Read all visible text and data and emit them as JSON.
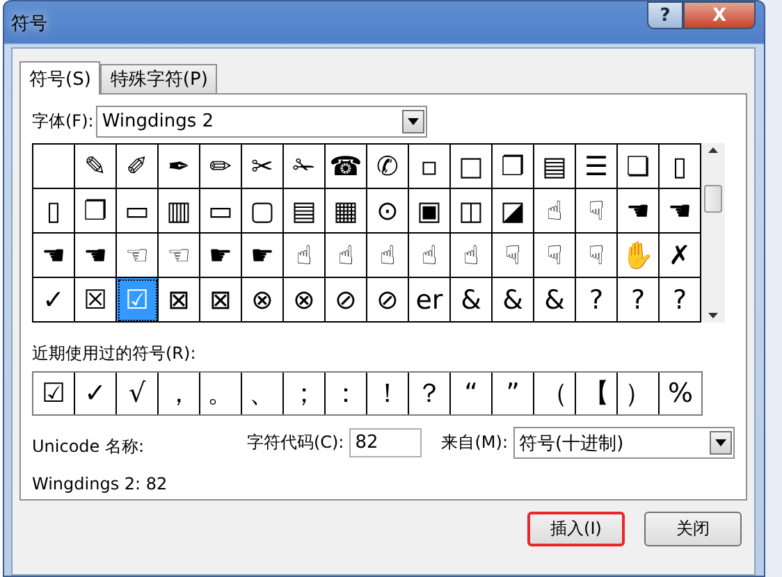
{
  "window": {
    "title": "符号",
    "help_button": "?",
    "close_button": "X"
  },
  "tabs": [
    {
      "label": "符号(S)",
      "selected": true
    },
    {
      "label": "特殊字符(P)",
      "selected": false
    }
  ],
  "font": {
    "label": "字体(F):",
    "value": "Wingdings 2"
  },
  "symbols": [
    {
      "selected": false
    },
    {
      "glyph": "✎",
      "selected": false
    },
    {
      "glyph": "✐",
      "selected": false
    },
    {
      "glyph": "✒",
      "selected": false
    },
    {
      "glyph": "✏",
      "selected": false
    },
    {
      "glyph": "✂",
      "selected": false
    },
    {
      "glyph": "✁",
      "selected": false
    },
    {
      "glyph": "☎",
      "selected": false
    },
    {
      "glyph": "✆",
      "selected": false
    },
    {
      "glyph": "▫",
      "selected": false
    },
    {
      "glyph": "□",
      "selected": false
    },
    {
      "glyph": "❐",
      "selected": false
    },
    {
      "glyph": "▤",
      "selected": false
    },
    {
      "glyph": "☰",
      "selected": false
    },
    {
      "glyph": "❏",
      "selected": false
    },
    {
      "glyph": "▯",
      "selected": false
    },
    {
      "glyph": "▯",
      "selected": false
    },
    {
      "glyph": "❐",
      "selected": false
    },
    {
      "glyph": "▭",
      "selected": false
    },
    {
      "glyph": "▥",
      "selected": false
    },
    {
      "glyph": "▭",
      "selected": false
    },
    {
      "glyph": "▢",
      "selected": false
    },
    {
      "glyph": "▤",
      "selected": false
    },
    {
      "glyph": "▦",
      "selected": false
    },
    {
      "glyph": "⊙",
      "selected": false
    },
    {
      "glyph": "▣",
      "selected": false
    },
    {
      "glyph": "◫",
      "selected": false
    },
    {
      "glyph": "◪",
      "selected": false
    },
    {
      "glyph": "☝",
      "selected": false
    },
    {
      "glyph": "☟",
      "selected": false
    },
    {
      "glyph": "☚",
      "selected": false
    },
    {
      "glyph": "☚",
      "selected": false
    },
    {
      "glyph": "☚",
      "selected": false
    },
    {
      "glyph": "☚",
      "selected": false
    },
    {
      "glyph": "☜",
      "selected": false
    },
    {
      "glyph": "☜",
      "selected": false
    },
    {
      "glyph": "☛",
      "selected": false
    },
    {
      "glyph": "☛",
      "selected": false
    },
    {
      "glyph": "☝",
      "selected": false
    },
    {
      "glyph": "☝",
      "selected": false
    },
    {
      "glyph": "☝",
      "selected": false
    },
    {
      "glyph": "☝",
      "selected": false
    },
    {
      "glyph": "☝",
      "selected": false
    },
    {
      "glyph": "☟",
      "selected": false
    },
    {
      "glyph": "☟",
      "selected": false
    },
    {
      "glyph": "☟",
      "selected": false
    },
    {
      "glyph": "✋",
      "selected": false
    },
    {
      "glyph": "✗",
      "selected": false
    },
    {
      "glyph": "✓",
      "selected": false
    },
    {
      "glyph": "☒",
      "selected": false
    },
    {
      "glyph": "☑",
      "selected": true
    },
    {
      "glyph": "⊠",
      "selected": false
    },
    {
      "glyph": "⊠",
      "selected": false
    },
    {
      "glyph": "⊗",
      "selected": false
    },
    {
      "glyph": "⊗",
      "selected": false
    },
    {
      "glyph": "⊘",
      "selected": false
    },
    {
      "glyph": "⊘",
      "selected": false
    },
    {
      "glyph": "er",
      "selected": false
    },
    {
      "glyph": "&",
      "selected": false
    },
    {
      "glyph": "&",
      "selected": false
    },
    {
      "glyph": "&",
      "selected": false
    },
    {
      "glyph": "?",
      "selected": false
    },
    {
      "glyph": "?",
      "selected": false
    },
    {
      "glyph": "?",
      "selected": false
    }
  ],
  "recent": {
    "label": "近期使用过的符号(R):",
    "symbols": [
      "☑",
      "✓",
      "√",
      "，",
      "。",
      "、",
      "；",
      "：",
      "！",
      "？",
      "“",
      "”",
      "（",
      "【",
      "）",
      "%"
    ]
  },
  "unicode_name": {
    "label": "Unicode 名称:",
    "value": "Wingdings 2: 82"
  },
  "char_code": {
    "label": "字符代码(C):",
    "value": "82"
  },
  "from": {
    "label": "来自(M):",
    "value": "符号(十进制)"
  },
  "buttons": [
    {
      "label": "插入(I)",
      "highlighted": true
    },
    {
      "label": "关闭",
      "highlighted": false
    }
  ]
}
